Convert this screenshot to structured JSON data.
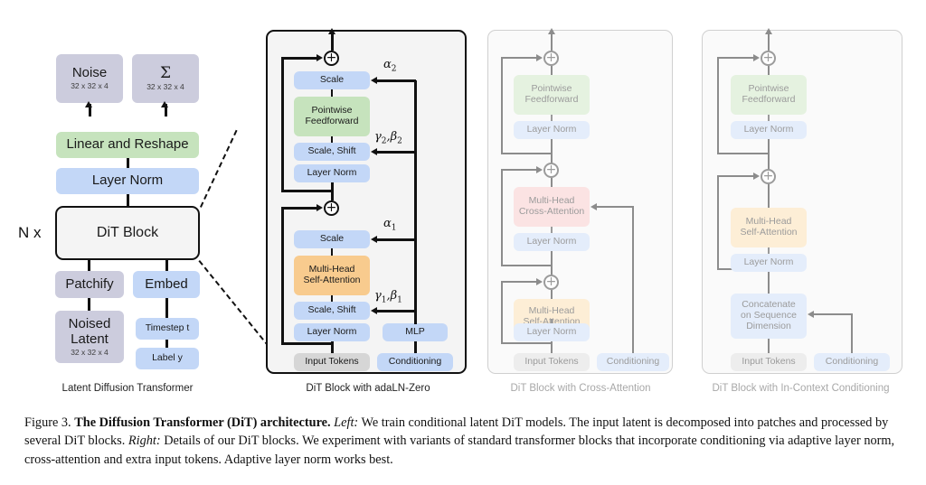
{
  "figure": {
    "number": "Figure 3.",
    "title": "The Diffusion Transformer (DiT) architecture.",
    "left_tag": "Left:",
    "left_text": " We train conditional latent DiT models. The input latent is decomposed into patches and processed by several DiT blocks. ",
    "right_tag": "Right:",
    "right_text": " Details of our DiT blocks. We experiment with variants of standard transformer blocks that incorporate conditioning via adaptive layer norm, cross-attention and extra input tokens. Adaptive layer norm works best."
  },
  "panel_captions": {
    "latent_diffusion_transformer": "Latent Diffusion Transformer",
    "adaln_zero": "DiT Block with adaLN-Zero",
    "cross_attention": "DiT Block with Cross-Attention",
    "in_context": "DiT Block with In-Context Conditioning"
  },
  "left_panel": {
    "repeat_label": "N x",
    "noise": {
      "label": "Noise",
      "shape": "32 x 32 x 4"
    },
    "sigma": {
      "label": "Σ",
      "shape": "32 x 32 x 4"
    },
    "linear_reshape": "Linear and Reshape",
    "layer_norm": "Layer Norm",
    "dit_block": "DiT Block",
    "patchify": "Patchify",
    "embed": "Embed",
    "noised_latent": {
      "label_line1": "Noised",
      "label_line2": "Latent",
      "shape": "32 x 32 x 4"
    },
    "timestep": "Timestep t",
    "label_y": "Label y"
  },
  "adaln_panel": {
    "scale_top": "Scale",
    "pointwise_feedforward_l1": "Pointwise",
    "pointwise_feedforward_l2": "Feedforward",
    "scale_shift_top": "Scale, Shift",
    "layer_norm_top": "Layer Norm",
    "scale_bottom": "Scale",
    "mhsa_l1": "Multi-Head",
    "mhsa_l2": "Self-Attention",
    "scale_shift_bottom": "Scale, Shift",
    "layer_norm_bottom": "Layer Norm",
    "mlp": "MLP",
    "input_tokens": "Input Tokens",
    "conditioning": "Conditioning",
    "alpha2": "α",
    "alpha2_sub": "2",
    "gamma_beta_2": "γ",
    "gamma_beta_2_sub": "2",
    "gamma_beta_2_b": "β",
    "gamma_beta_2_b_sub": "2",
    "alpha1": "α",
    "alpha1_sub": "1",
    "gamma_beta_1": "γ",
    "gamma_beta_1_sub": "1",
    "gamma_beta_1_b": "β",
    "gamma_beta_1_b_sub": "1",
    "plus_symbol": "+"
  },
  "cross_attention_panel": {
    "pointwise_feedforward_l1": "Pointwise",
    "pointwise_feedforward_l2": "Feedforward",
    "layer_norm_1": "Layer Norm",
    "mhca_l1": "Multi-Head",
    "mhca_l2": "Cross-Attention",
    "layer_norm_2": "Layer Norm",
    "mhsa_l1": "Multi-Head",
    "mhsa_l2": "Self-Attention",
    "layer_norm_3": "Layer Norm",
    "input_tokens": "Input Tokens",
    "conditioning": "Conditioning",
    "plus_symbol": "+"
  },
  "in_context_panel": {
    "pointwise_feedforward_l1": "Pointwise",
    "pointwise_feedforward_l2": "Feedforward",
    "layer_norm_1": "Layer Norm",
    "mhsa_l1": "Multi-Head",
    "mhsa_l2": "Self-Attention",
    "layer_norm_2": "Layer Norm",
    "concat_l1": "Concatenate",
    "concat_l2": "on Sequence",
    "concat_l3": "Dimension",
    "input_tokens": "Input Tokens",
    "conditioning": "Conditioning",
    "plus_symbol": "+"
  },
  "colors": {
    "grey": "#ccccdd",
    "blue": "#c3d7f7",
    "green": "#c6e3bd",
    "orange": "#f8cb8e",
    "red": "#f6c6c6",
    "light_grey": "#d6d6d6",
    "outline": "#111111",
    "panel_bg": "#f4f4f4"
  }
}
